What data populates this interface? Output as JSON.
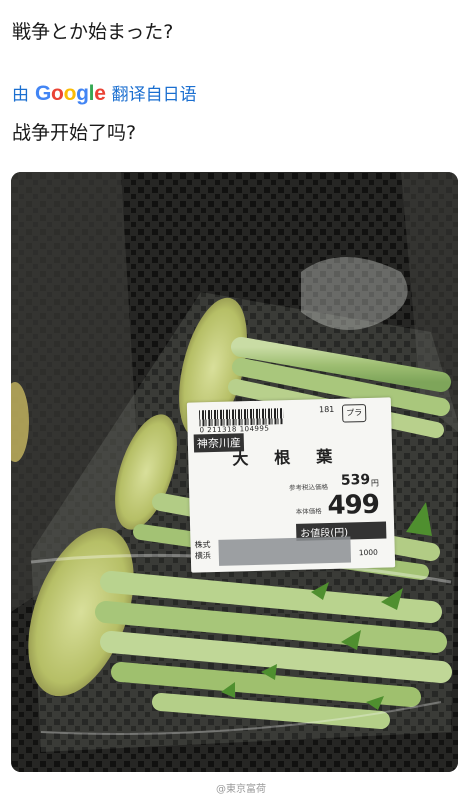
{
  "post": {
    "text": "戦争とか始まった?"
  },
  "translate": {
    "by": "由",
    "brand": "Google",
    "label": "翻译自日语"
  },
  "translation": {
    "text": "战争开始了吗?"
  },
  "price_tag": {
    "barcode_number": "0 211318 104995",
    "tag_number": "181",
    "tag_mark": "プラ",
    "origin": "神奈川産",
    "product_name": "大根葉",
    "ref_price_label": "参考税込価格",
    "ref_price": "539",
    "ref_price_unit": "円",
    "base_price_label": "本体価格",
    "price": "499",
    "price_caption": "お値段(円)",
    "company": "株式\n横浜",
    "code": "1000"
  },
  "watermark": "@東京富荷",
  "colors": {
    "link_blue": "#1b6fd0",
    "google_blue": "#4285F4",
    "google_red": "#EA4335",
    "google_yellow": "#FBBC05",
    "google_green": "#34A853"
  }
}
